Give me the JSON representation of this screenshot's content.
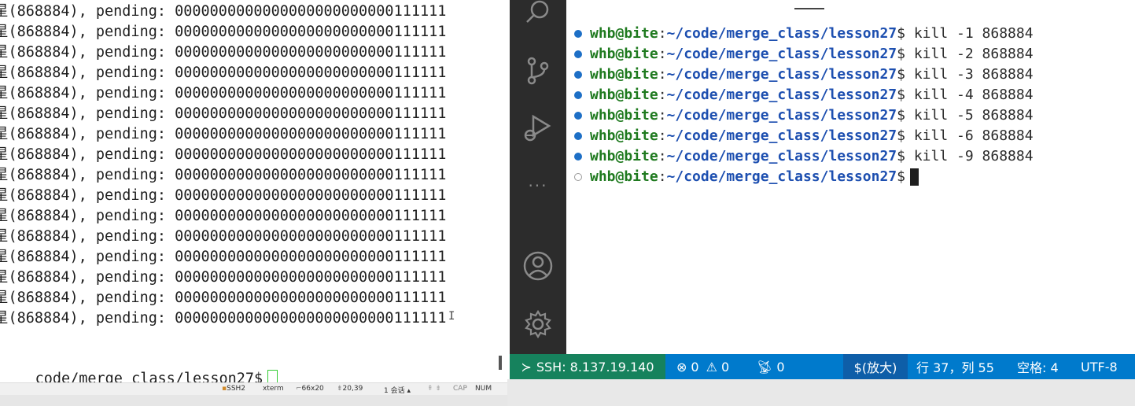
{
  "left_terminal": {
    "lines": [
      "星(868884), pending: 0000000000000000000000000111111",
      "星(868884), pending: 0000000000000000000000000111111",
      "星(868884), pending: 0000000000000000000000000111111",
      "星(868884), pending: 0000000000000000000000000111111",
      "星(868884), pending: 0000000000000000000000000111111",
      "星(868884), pending: 0000000000000000000000000111111",
      "星(868884), pending: 0000000000000000000000000111111",
      "星(868884), pending: 0000000000000000000000000111111",
      "星(868884), pending: 0000000000000000000000000111111",
      "星(868884), pending: 0000000000000000000000000111111",
      "星(868884), pending: 0000000000000000000000000111111",
      "星(868884), pending: 0000000000000000000000000111111",
      "星(868884), pending: 0000000000000000000000000111111",
      "星(868884), pending: 0000000000000000000000000111111",
      "星(868884), pending: 0000000000000000000000000111111",
      "星(868884), pending: 0000000000000000000000000111111"
    ],
    "prompt": "code/merge_class/lesson27$",
    "status": {
      "ssh": "SSH2",
      "term": "xterm",
      "size": "66x20",
      "pos": "20,39",
      "sessions": "1 会话",
      "cap": "CAP",
      "num": "NUM"
    }
  },
  "vscode_terminal": {
    "lines": [
      {
        "user": "whb@bite",
        "path": "~/code/merge_class/lesson27",
        "cmd": "$ kill -1 868884",
        "done": true
      },
      {
        "user": "whb@bite",
        "path": "~/code/merge_class/lesson27",
        "cmd": "$ kill -2 868884",
        "done": true
      },
      {
        "user": "whb@bite",
        "path": "~/code/merge_class/lesson27",
        "cmd": "$ kill -3 868884",
        "done": true
      },
      {
        "user": "whb@bite",
        "path": "~/code/merge_class/lesson27",
        "cmd": "$ kill -4 868884",
        "done": true
      },
      {
        "user": "whb@bite",
        "path": "~/code/merge_class/lesson27",
        "cmd": "$ kill -5 868884",
        "done": true
      },
      {
        "user": "whb@bite",
        "path": "~/code/merge_class/lesson27",
        "cmd": "$ kill -6 868884",
        "done": true
      },
      {
        "user": "whb@bite",
        "path": "~/code/merge_class/lesson27",
        "cmd": "$ kill -9 868884",
        "done": true
      },
      {
        "user": "whb@bite",
        "path": "~/code/merge_class/lesson27",
        "cmd": "$",
        "done": false
      }
    ]
  },
  "activity_bar": {
    "icons": [
      "search-icon",
      "source-control-icon",
      "run-debug-icon",
      "more-icon",
      "account-icon",
      "settings-gear-icon"
    ]
  },
  "statusbar": {
    "remote": "SSH: 8.137.19.140",
    "errors": "0",
    "warnings": "0",
    "ports": "0",
    "mode": "$(放大)",
    "position": "行 37，列 55",
    "spaces": "空格: 4",
    "encoding": "UTF-8"
  },
  "colors": {
    "statusbar_bg": "#007acc",
    "remote_bg": "#16825d",
    "activity_bg": "#2c2c2c",
    "prompt_user": "#1f7a1f",
    "prompt_path": "#1d4fb0"
  }
}
